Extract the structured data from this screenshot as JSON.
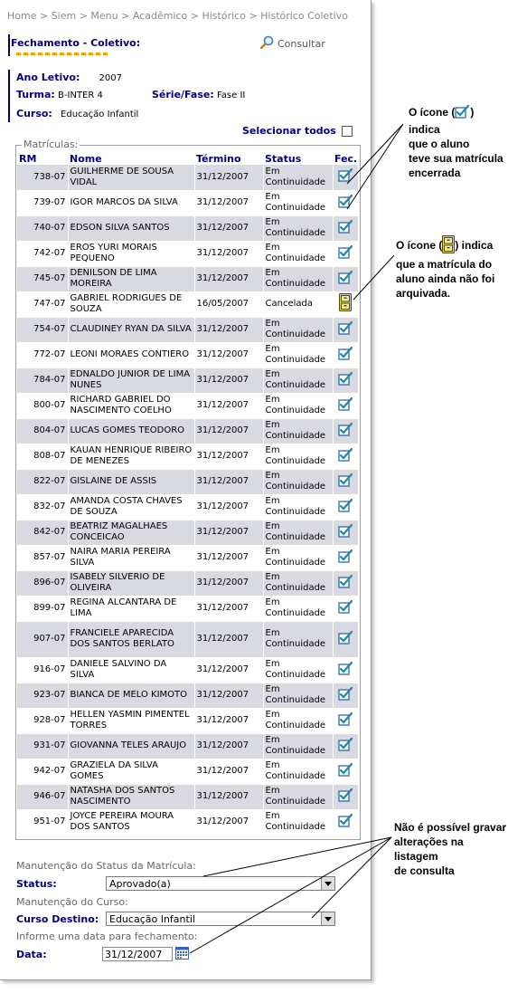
{
  "breadcrumb": "Home > Siem > Menu > Acadêmico > Histórico > Histórico Coletivo",
  "section_title": "Fechamento - Coletivo:",
  "consultar_label": "Consultar",
  "info": {
    "ano_label": "Ano Letivo:",
    "ano_value": "2007",
    "turma_label": "Turma:",
    "turma_value": "B-INTER 4",
    "serie_label": "Série/Fase:",
    "serie_value": "Fase II",
    "curso_label": "Curso:",
    "curso_value": "Educação Infantil"
  },
  "select_all_label": "Selecionar todos",
  "fieldset_legend": "Matrículas:",
  "columns": [
    "RM",
    "Nome",
    "Término",
    "Status",
    "Fec."
  ],
  "rows": [
    {
      "rm": "738-07",
      "nome": "GUILHERME DE SOUSA VIDAL",
      "termino": "31/12/2007",
      "status": "Em Continuidade",
      "icon": "encerrada"
    },
    {
      "rm": "739-07",
      "nome": "IGOR MARCOS DA SILVA",
      "termino": "31/12/2007",
      "status": "Em Continuidade",
      "icon": "encerrada"
    },
    {
      "rm": "740-07",
      "nome": "EDSON SILVA SANTOS",
      "termino": "31/12/2007",
      "status": "Em Continuidade",
      "icon": "encerrada"
    },
    {
      "rm": "742-07",
      "nome": "EROS YURI MORAIS PEQUENO",
      "termino": "31/12/2007",
      "status": "Em Continuidade",
      "icon": "encerrada"
    },
    {
      "rm": "745-07",
      "nome": "DENILSON DE LIMA MOREIRA",
      "termino": "31/12/2007",
      "status": "Em Continuidade",
      "icon": "encerrada"
    },
    {
      "rm": "747-07",
      "nome": "GABRIEL RODRIGUES DE SOUZA",
      "termino": "16/05/2007",
      "status": "Cancelada",
      "icon": "nao-arquivada"
    },
    {
      "rm": "754-07",
      "nome": "CLAUDINEY RYAN DA SILVA",
      "termino": "31/12/2007",
      "status": "Em Continuidade",
      "icon": "encerrada"
    },
    {
      "rm": "772-07",
      "nome": "LEONI MORAES CONTIERO",
      "termino": "31/12/2007",
      "status": "Em Continuidade",
      "icon": "encerrada"
    },
    {
      "rm": "784-07",
      "nome": "EDNALDO JUNIOR DE LIMA NUNES",
      "termino": "31/12/2007",
      "status": "Em Continuidade",
      "icon": "encerrada"
    },
    {
      "rm": "800-07",
      "nome": "RICHARD GABRIEL DO NASCIMENTO COELHO",
      "termino": "31/12/2007",
      "status": "Em Continuidade",
      "icon": "encerrada"
    },
    {
      "rm": "804-07",
      "nome": "LUCAS GOMES TEODORO",
      "termino": "31/12/2007",
      "status": "Em Continuidade",
      "icon": "encerrada"
    },
    {
      "rm": "808-07",
      "nome": "KAUAN HENRIQUE RIBEIRO DE MENEZES",
      "termino": "31/12/2007",
      "status": "Em Continuidade",
      "icon": "encerrada"
    },
    {
      "rm": "822-07",
      "nome": "GISLAINE DE ASSIS",
      "termino": "31/12/2007",
      "status": "Em Continuidade",
      "icon": "encerrada"
    },
    {
      "rm": "832-07",
      "nome": "AMANDA COSTA CHAVES DE SOUZA",
      "termino": "31/12/2007",
      "status": "Em Continuidade",
      "icon": "encerrada"
    },
    {
      "rm": "842-07",
      "nome": "BEATRIZ MAGALHAES CONCEICAO",
      "termino": "31/12/2007",
      "status": "Em Continuidade",
      "icon": "encerrada"
    },
    {
      "rm": "857-07",
      "nome": "NAIRA MARIA PEREIRA SILVA",
      "termino": "31/12/2007",
      "status": "Em Continuidade",
      "icon": "encerrada"
    },
    {
      "rm": "896-07",
      "nome": "ISABELY SILVERIO DE OLIVEIRA",
      "termino": "31/12/2007",
      "status": "Em Continuidade",
      "icon": "encerrada"
    },
    {
      "rm": "899-07",
      "nome": "REGINA ALCANTARA DE LIMA",
      "termino": "31/12/2007",
      "status": "Em Continuidade",
      "icon": "encerrada"
    },
    {
      "rm": "907-07",
      "nome": "FRANCIELE APARECIDA DOS SANTOS BERLATO",
      "termino": "31/12/2007",
      "status": "Em Continuidade",
      "icon": "encerrada"
    },
    {
      "rm": "916-07",
      "nome": "DANIELE SALVINO DA SILVA",
      "termino": "31/12/2007",
      "status": "Em Continuidade",
      "icon": "encerrada"
    },
    {
      "rm": "923-07",
      "nome": "BIANCA DE MELO KIMOTO",
      "termino": "31/12/2007",
      "status": "Em Continuidade",
      "icon": "encerrada"
    },
    {
      "rm": "928-07",
      "nome": "HELLEN YASMIN PIMENTEL TORRES",
      "termino": "31/12/2007",
      "status": "Em Continuidade",
      "icon": "encerrada"
    },
    {
      "rm": "931-07",
      "nome": "GIOVANNA TELES ARAUJO",
      "termino": "31/12/2007",
      "status": "Em Continuidade",
      "icon": "encerrada"
    },
    {
      "rm": "942-07",
      "nome": "GRAZIELA DA SILVA GOMES",
      "termino": "31/12/2007",
      "status": "Em Continuidade",
      "icon": "encerrada"
    },
    {
      "rm": "946-07",
      "nome": "NATASHA DOS SANTOS NASCIMENTO",
      "termino": "31/12/2007",
      "status": "Em Continuidade",
      "icon": "encerrada"
    },
    {
      "rm": "951-07",
      "nome": "JOYCE PEREIRA MOURA DOS SANTOS",
      "termino": "31/12/2007",
      "status": "Em Continuidade",
      "icon": "encerrada"
    }
  ],
  "maint_status_label": "Manutenção do Status da Matrícula:",
  "status_label": "Status:",
  "status_value": "Aprovado(a)",
  "maint_curso_label": "Manutenção do Curso:",
  "curso_destino_label": "Curso Destino:",
  "curso_destino_value": "Educação Infantil",
  "data_fech_label": "Informe uma data para fechamento:",
  "data_label": "Data:",
  "data_value": "31/12/2007",
  "notes": {
    "n1_a": "O ícone (",
    "n1_b": ") indica",
    "n1_c": "que o aluno",
    "n1_d": "teve sua matrícula",
    "n1_e": "encerrada",
    "n2_a": "O ícone (",
    "n2_b": ") indica",
    "n2_c": "que a matrícula do",
    "n2_d": "aluno ainda não foi",
    "n2_e": "arquivada.",
    "n3_a": "Não é possível gravar",
    "n3_b": "alterações na listagem",
    "n3_c": "de consulta"
  },
  "colors": {
    "accent": "#000080",
    "row_alt": "#d9d9e1",
    "underline": "#f0a000"
  }
}
